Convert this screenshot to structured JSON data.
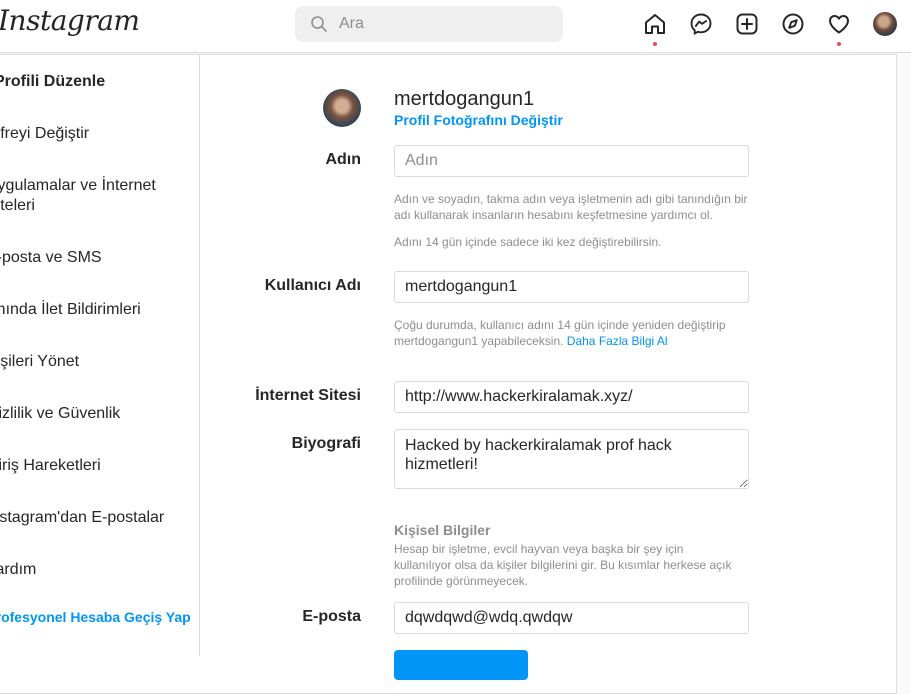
{
  "header": {
    "logo": "Instagram",
    "search_placeholder": "Ara"
  },
  "sidebar": {
    "items": [
      {
        "label": "Profili Düzenle"
      },
      {
        "label": "Şifreyi Değiştir"
      },
      {
        "label": "Uygulamalar ve İnternet Siteleri"
      },
      {
        "label": "E-posta ve SMS"
      },
      {
        "label": "Anında İlet Bildirimleri"
      },
      {
        "label": "Kişileri Yönet"
      },
      {
        "label": "Gizlilik ve Güvenlik"
      },
      {
        "label": "Giriş Hareketleri"
      },
      {
        "label": "Instagram'dan E-postalar"
      },
      {
        "label": "Yardım"
      }
    ],
    "pro_link": "Profesyonel Hesaba Geçiş Yap"
  },
  "profile": {
    "username": "mertdogangun1",
    "change_photo": "Profil Fotoğrafını Değiştir"
  },
  "form": {
    "name": {
      "label": "Adın",
      "value": "",
      "placeholder": "Adın",
      "help1": "Adın ve soyadın, takma adın veya işletmenin adı gibi tanındığın bir adı kullanarak insanların hesabını keşfetmesine yardımcı ol.",
      "help2": "Adını 14 gün içinde sadece iki kez değiştirebilirsin."
    },
    "username": {
      "label": "Kullanıcı Adı",
      "value": "mertdogangun1",
      "help": "Çoğu durumda, kullanıcı adını 14 gün içinde yeniden değiştirip mertdogangun1 yapabileceksin.",
      "help_link": "Daha Fazla Bilgi Al"
    },
    "website": {
      "label": "İnternet Sitesi",
      "value": "http://www.hackerkiralamak.xyz/"
    },
    "bio": {
      "label": "Biyografi",
      "value": "Hacked by hackerkiralamak prof hack hizmetleri!"
    },
    "personal": {
      "title": "Kişisel Bilgiler",
      "help": "Hesap bir işletme, evcil hayvan veya başka bir şey için kullanılıyor olsa da kişiler bilgilerini gir. Bu kısımlar herkese açık profilinde görünmeyecek."
    },
    "email": {
      "label": "E-posta",
      "value": "dqwdqwd@wdq.qwdqw"
    }
  },
  "colors": {
    "accent": "#0095f6",
    "notification": "#ed4956",
    "border": "#dbdbdb",
    "muted": "#8e8e8e"
  }
}
